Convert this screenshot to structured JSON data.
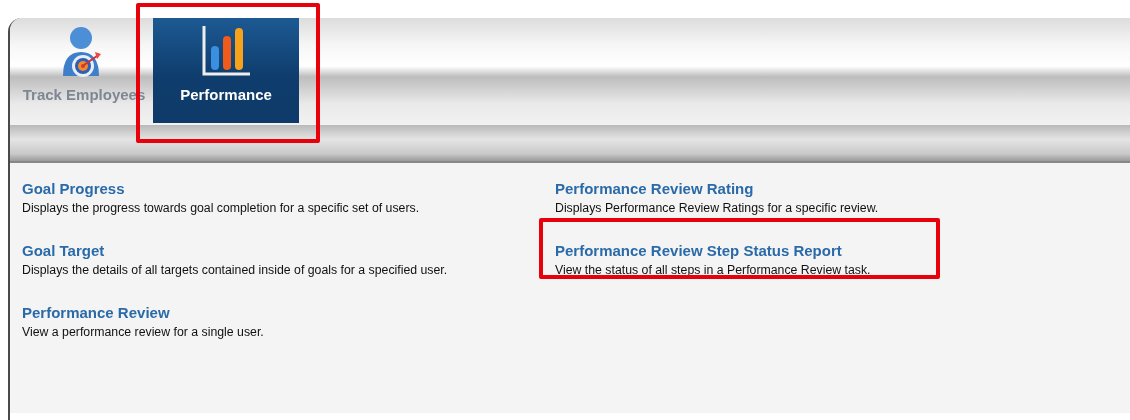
{
  "tabs": [
    {
      "label": "Track Employees",
      "selected": false,
      "highlighted": false
    },
    {
      "label": "Performance",
      "selected": true,
      "highlighted": true
    }
  ],
  "reports": [
    {
      "title": "Goal Progress",
      "description": "Displays the progress towards goal completion for a specific set of users.",
      "highlighted": false
    },
    {
      "title": "Performance Review Rating",
      "description": "Displays Performance Review Ratings for a specific review.",
      "highlighted": false
    },
    {
      "title": "Goal Target",
      "description": "Displays the details of all targets contained inside of goals for a specified user.",
      "highlighted": false
    },
    {
      "title": "Performance Review Step Status Report",
      "description": "View the status of all steps in a Performance Review task.",
      "highlighted": true
    },
    {
      "title": "Performance Review",
      "description": "View a performance review for a single user.",
      "highlighted": false
    }
  ]
}
